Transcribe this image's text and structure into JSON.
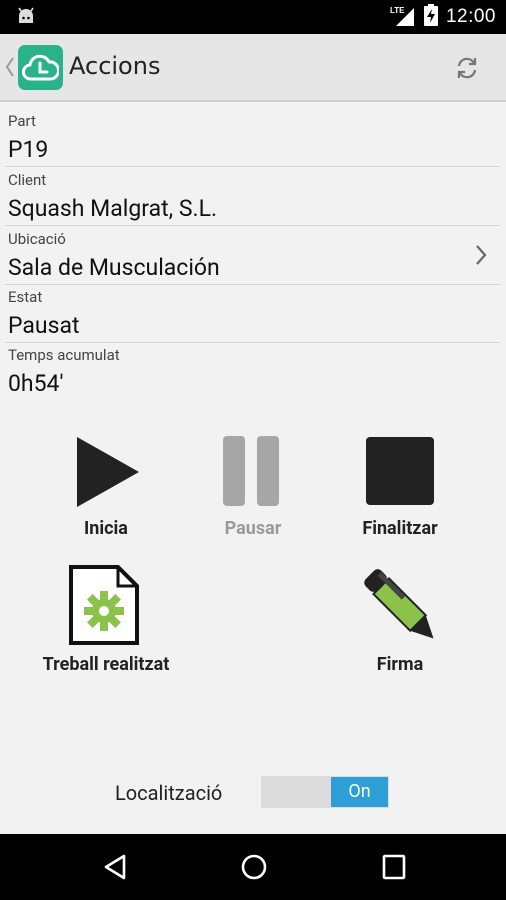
{
  "status_bar": {
    "time": "12:00",
    "network": "LTE"
  },
  "action_bar": {
    "title": "Accions"
  },
  "fields": [
    {
      "label": "Part",
      "value": "P19"
    },
    {
      "label": "Client",
      "value": "Squash Malgrat, S.L."
    },
    {
      "label": "Ubicació",
      "value": "Sala de Musculación"
    },
    {
      "label": "Estat",
      "value": "Pausat"
    },
    {
      "label": "Temps acumulat",
      "value": "0h54'"
    }
  ],
  "actions": {
    "start": "Inicia",
    "pause": "Pausar",
    "finish": "Finalitzar",
    "work_done": "Treball realitzat",
    "signature": "Firma"
  },
  "location": {
    "label": "Localització",
    "toggle_state": "On"
  },
  "colors": {
    "accent": "#2ab38a",
    "toggle_on": "#2e9fd6",
    "disabled": "#9a9a9a"
  }
}
